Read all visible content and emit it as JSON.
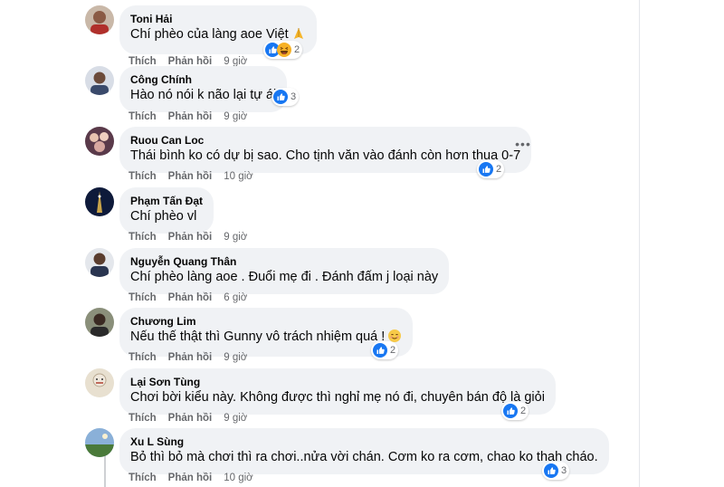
{
  "comments": [
    {
      "author": "Toni Hải",
      "text": "Chí phèo của làng aoe Việt",
      "like": "Thích",
      "reply": "Phản hồi",
      "time": "9 giờ",
      "reaction_count": "2",
      "reactions": [
        "like-icon",
        "haha-icon"
      ],
      "text_emoji": "folded-hands-icon"
    },
    {
      "author": "Công Chính",
      "text": "Hào nó nói k não lại tự ái",
      "like": "Thích",
      "reply": "Phản hồi",
      "time": "9 giờ",
      "reaction_count": "3",
      "reactions": [
        "like-icon"
      ]
    },
    {
      "author": "Ruou Can Loc",
      "text": "Thái bình ko có dự bị sao. Cho tịnh văn vào đánh còn hơn thua 0-7",
      "like": "Thích",
      "reply": "Phản hồi",
      "time": "10 giờ",
      "reaction_count": "2",
      "reactions": [
        "like-icon"
      ]
    },
    {
      "author": "Phạm Tấn Đạt",
      "text": "Chí phèo vl",
      "like": "Thích",
      "reply": "Phản hồi",
      "time": "9 giờ"
    },
    {
      "author": "Nguyễn Quang Thân",
      "text": "Chí phèo làng aoe . Đuổi mẹ đi . Đánh đấm j loại này",
      "like": "Thích",
      "reply": "Phản hồi",
      "time": "6 giờ"
    },
    {
      "author": "Chương Lim",
      "text": "Nếu thế thật thì Gunny vô trách nhiệm quá !",
      "like": "Thích",
      "reply": "Phản hồi",
      "time": "9 giờ",
      "reaction_count": "2",
      "reactions": [
        "like-icon"
      ],
      "text_emoji": "smiling-face-icon"
    },
    {
      "author": "Lại Sơn Tùng",
      "text": "Chơi bời kiểu này. Không được thì nghỉ mẹ nó đi, chuyên bán độ là giỏi",
      "like": "Thích",
      "reply": "Phản hồi",
      "time": "9 giờ",
      "reaction_count": "2",
      "reactions": [
        "like-icon"
      ]
    },
    {
      "author": "Xu L Sùng",
      "text": "Bỏ thì bỏ mà chơi thì ra chơi..nửa vời chán. Cơm ko ra cơm, chao ko thah cháo.",
      "like": "Thích",
      "reply": "Phản hồi",
      "time": "10 giờ",
      "reaction_count": "3",
      "reactions": [
        "like-icon"
      ]
    }
  ],
  "colors": {
    "like_blue": "#1877f2",
    "haha_yellow": "#f7b125",
    "bubble_bg": "#f0f2f5",
    "meta_gray": "#65676b"
  },
  "more_icon": "more-options-icon"
}
